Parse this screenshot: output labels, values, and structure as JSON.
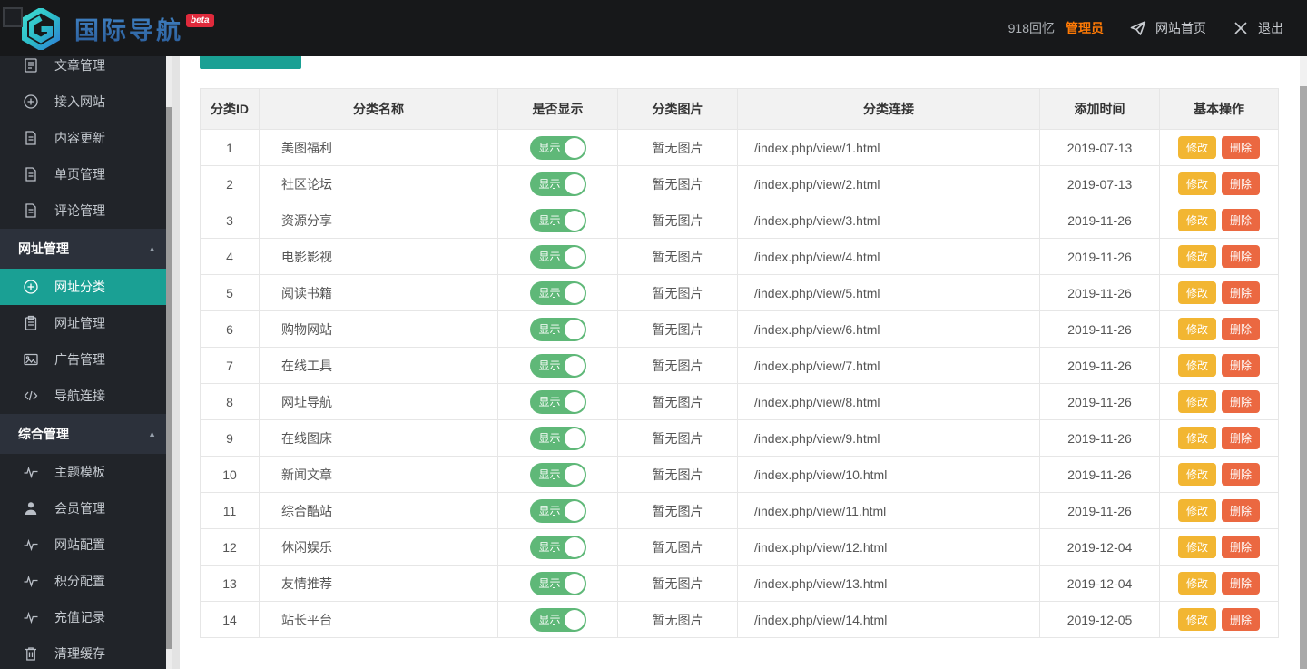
{
  "navbar": {
    "brand": "国际导航",
    "badge": "beta",
    "username": "918回忆",
    "role": "管理员",
    "home_link": "网站首页",
    "logout": "退出"
  },
  "sidebar": {
    "items": [
      {
        "type": "item",
        "label": "文章管理",
        "icon": "article-icon"
      },
      {
        "type": "item",
        "label": "接入网站",
        "icon": "plus-circle-icon"
      },
      {
        "type": "item",
        "label": "内容更新",
        "icon": "file-icon"
      },
      {
        "type": "item",
        "label": "单页管理",
        "icon": "file-icon"
      },
      {
        "type": "item",
        "label": "评论管理",
        "icon": "file-icon"
      },
      {
        "type": "section",
        "label": "网址管理"
      },
      {
        "type": "item",
        "label": "网址分类",
        "icon": "plus-circle-icon",
        "active": true
      },
      {
        "type": "item",
        "label": "网址管理",
        "icon": "clipboard-icon"
      },
      {
        "type": "item",
        "label": "广告管理",
        "icon": "image-icon"
      },
      {
        "type": "item",
        "label": "导航连接",
        "icon": "code-icon"
      },
      {
        "type": "section",
        "label": "综合管理"
      },
      {
        "type": "item",
        "label": "主题模板",
        "icon": "pulse-icon"
      },
      {
        "type": "item",
        "label": "会员管理",
        "icon": "user-icon"
      },
      {
        "type": "item",
        "label": "网站配置",
        "icon": "pulse-icon"
      },
      {
        "type": "item",
        "label": "积分配置",
        "icon": "pulse-icon"
      },
      {
        "type": "item",
        "label": "充值记录",
        "icon": "pulse-icon"
      },
      {
        "type": "item",
        "label": "清理缓存",
        "icon": "trash-icon"
      }
    ]
  },
  "table": {
    "headers": [
      "分类ID",
      "分类名称",
      "是否显示",
      "分类图片",
      "分类连接",
      "添加时间",
      "基本操作"
    ],
    "toggle_label": "显示",
    "no_image_label": "暂无图片",
    "edit_label": "修改",
    "delete_label": "删除",
    "rows": [
      {
        "id": "1",
        "name": "美图福利",
        "url": "/index.php/view/1.html",
        "date": "2019-07-13"
      },
      {
        "id": "2",
        "name": "社区论坛",
        "url": "/index.php/view/2.html",
        "date": "2019-07-13"
      },
      {
        "id": "3",
        "name": "资源分享",
        "url": "/index.php/view/3.html",
        "date": "2019-11-26"
      },
      {
        "id": "4",
        "name": "电影影视",
        "url": "/index.php/view/4.html",
        "date": "2019-11-26"
      },
      {
        "id": "5",
        "name": "阅读书籍",
        "url": "/index.php/view/5.html",
        "date": "2019-11-26"
      },
      {
        "id": "6",
        "name": "购物网站",
        "url": "/index.php/view/6.html",
        "date": "2019-11-26"
      },
      {
        "id": "7",
        "name": "在线工具",
        "url": "/index.php/view/7.html",
        "date": "2019-11-26"
      },
      {
        "id": "8",
        "name": "网址导航",
        "url": "/index.php/view/8.html",
        "date": "2019-11-26"
      },
      {
        "id": "9",
        "name": "在线图床",
        "url": "/index.php/view/9.html",
        "date": "2019-11-26"
      },
      {
        "id": "10",
        "name": "新闻文章",
        "url": "/index.php/view/10.html",
        "date": "2019-11-26"
      },
      {
        "id": "11",
        "name": "综合酷站",
        "url": "/index.php/view/11.html",
        "date": "2019-11-26"
      },
      {
        "id": "12",
        "name": "休闲娱乐",
        "url": "/index.php/view/12.html",
        "date": "2019-12-04"
      },
      {
        "id": "13",
        "name": "友情推荐",
        "url": "/index.php/view/13.html",
        "date": "2019-12-04"
      },
      {
        "id": "14",
        "name": "站长平台",
        "url": "/index.php/view/14.html",
        "date": "2019-12-05"
      }
    ]
  },
  "colors": {
    "accent_teal": "#1AA094",
    "toggle_green": "#5FB878",
    "edit_yellow": "#F2B632",
    "delete_orange": "#EB6841",
    "role_orange": "#FF7A05",
    "badge_red": "#E02A3C",
    "navbar_bg": "#17181A",
    "sidebar_bg": "#212429",
    "sidebar_section_bg": "#2C313B"
  }
}
